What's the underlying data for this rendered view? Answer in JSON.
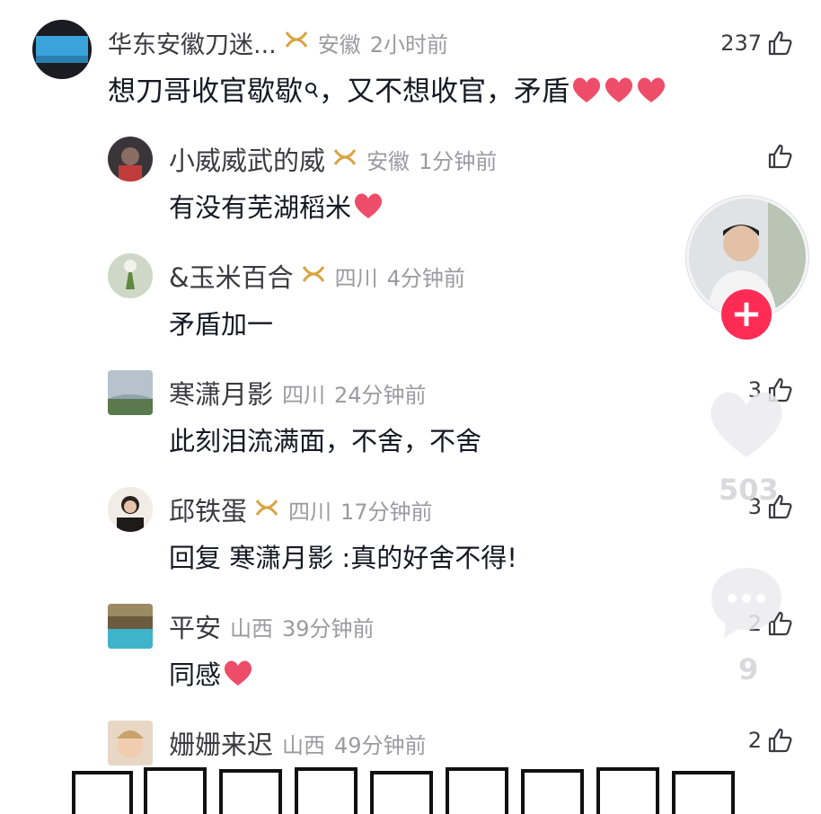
{
  "comments": [
    {
      "name": "华东安徽刀迷...",
      "location": "安徽",
      "time": "2小时前",
      "text": "想刀哥收官歇歇",
      "text_suffix": "，又不想收官，矛盾",
      "likes": "237"
    },
    {
      "name": "小威威武的威",
      "location": "安徽",
      "time": "1分钟前",
      "text": "有没有芜湖稻米",
      "likes": ""
    },
    {
      "name": "&玉米百合",
      "location": "四川",
      "time": "4分钟前",
      "text": "矛盾加一",
      "likes": ""
    },
    {
      "name": "寒潇月影",
      "location": "四川",
      "time": "24分钟前",
      "text": "此刻泪流满面，不舍，不舍",
      "likes": "3"
    },
    {
      "name": "邱铁蛋",
      "location": "四川",
      "time": "17分钟前",
      "text": "回复 寒潇月影 :真的好舍不得!",
      "likes": "3"
    },
    {
      "name": "平安",
      "location": "山西",
      "time": "39分钟前",
      "text": "同感",
      "likes": "2"
    },
    {
      "name": "姗姗来迟",
      "location": "山西",
      "time": "49分钟前",
      "text": "",
      "likes": "2"
    }
  ],
  "overlay": {
    "like_count": "503",
    "comment_count": "9",
    "follow_symbol": "+"
  },
  "colors": {
    "accent": "#fe2c55",
    "heart": "#ee4d6a",
    "badge": "#d9a441"
  }
}
